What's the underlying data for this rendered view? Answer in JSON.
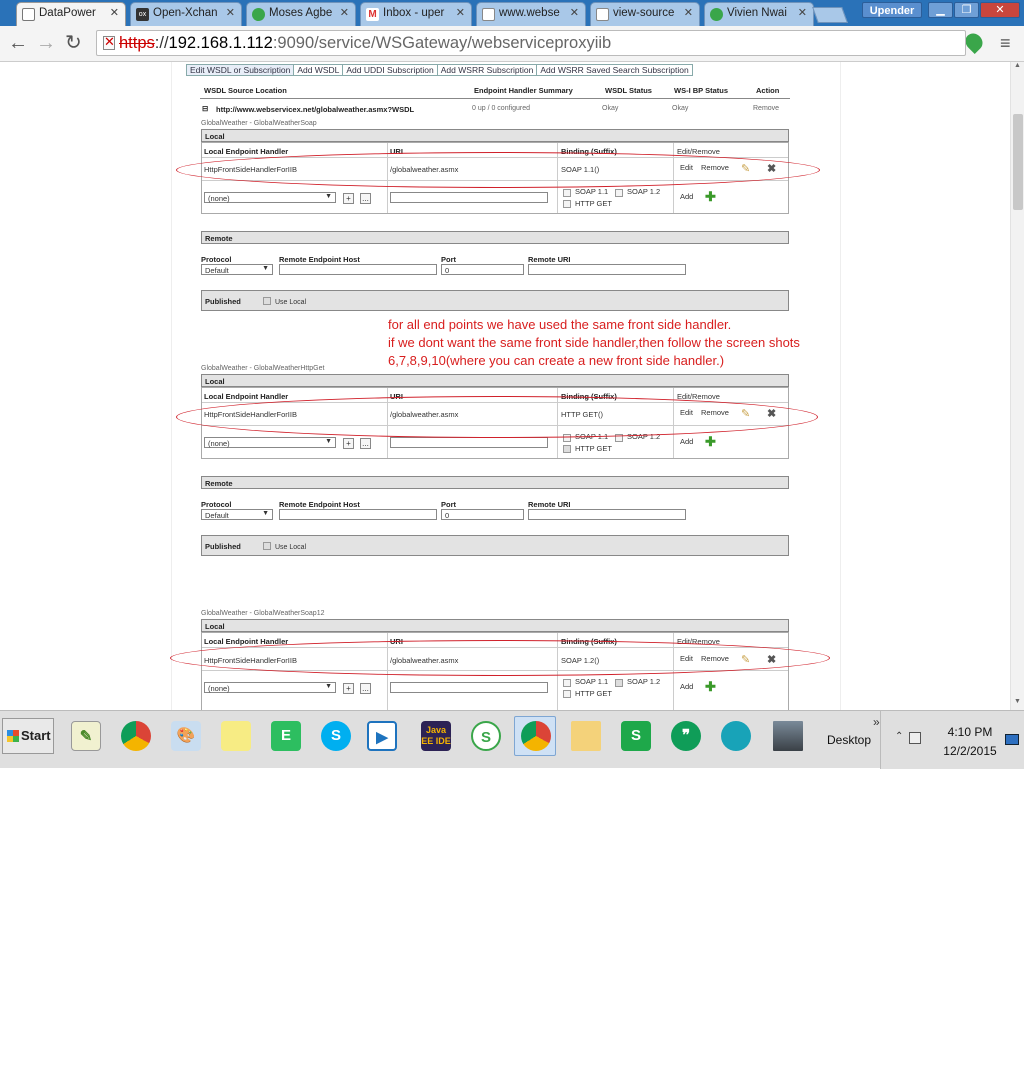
{
  "browser": {
    "tabs": [
      {
        "label": "DataPower",
        "icon": "datapower-doc-icon",
        "active": true
      },
      {
        "label": "Open-Xchan",
        "icon": "ox-icon"
      },
      {
        "label": "Moses Agbe",
        "icon": "globe-icon"
      },
      {
        "label": "Inbox - uper",
        "icon": "gmail-icon"
      },
      {
        "label": "www.webse",
        "icon": "page-icon"
      },
      {
        "label": "view-source",
        "icon": "page-icon"
      },
      {
        "label": "Vivien Nwai",
        "icon": "globe-icon"
      }
    ],
    "profile": "Upender",
    "url": {
      "scheme": "https",
      "sep": "://",
      "host": "192.168.1.112",
      "port": ":9090",
      "path": "/service/WSGateway/webserviceproxyiib"
    }
  },
  "wsdl_tabs": [
    "Edit WSDL or Subscription",
    "Add WSDL",
    "Add UDDI Subscription",
    "Add WSRR Subscription",
    "Add WSRR Saved Search Subscription"
  ],
  "wsdl_header": {
    "source": "WSDL Source Location",
    "summary": "Endpoint Handler Summary",
    "status": "WSDL Status",
    "wsi": "WS-I BP Status",
    "action": "Action"
  },
  "wsdl_row": {
    "toggle": "⊟",
    "location": "http://www.webservicex.net/globalweather.asmx?WSDL",
    "summary": "0 up / 0 configured",
    "status": "Okay",
    "wsi": "Okay",
    "action": "Remove"
  },
  "labels": {
    "local": "Local",
    "remote": "Remote",
    "published": "Published",
    "use_local": "Use Local",
    "handler_col": "Local Endpoint Handler",
    "uri_col": "URI",
    "binding_col": "Binding (Suffix)",
    "editremove_col": "Edit/Remove",
    "edit": "Edit",
    "remove": "Remove",
    "add": "Add",
    "none": "(none)",
    "plus": "+",
    "dots": "...",
    "soap11": "SOAP 1.1",
    "soap12": "SOAP 1.2",
    "httpget": "HTTP GET",
    "protocol": "Protocol",
    "remote_host": "Remote Endpoint Host",
    "port": "Port",
    "remote_uri": "Remote URI",
    "default": "Default",
    "port_value": "0"
  },
  "sections": [
    {
      "title": "GlobalWeather - GlobalWeatherSoap",
      "handler": "HttpFrontSideHandlerForIIB",
      "uri": "/globalweather.asmx",
      "binding": "SOAP 1.1()"
    },
    {
      "title": "GlobalWeather - GlobalWeatherHttpGet",
      "handler": "HttpFrontSideHandlerForIIB",
      "uri": "/globalweather.asmx",
      "binding": "HTTP GET()"
    },
    {
      "title": "GlobalWeather - GlobalWeatherSoap12",
      "handler": "HttpFrontSideHandlerForIIB",
      "uri": "/globalweather.asmx",
      "binding": "SOAP 1.2()"
    }
  ],
  "annotation": {
    "line1": "for all end points we have used the same front side handler.",
    "line2": "if we dont want the same front side handler,then follow the screen shots",
    "line3": "6,7,8,9,10(where you can create a new front side handler.)",
    "color": "#d81e1e"
  },
  "taskbar": {
    "start": "Start",
    "desktop": "Desktop",
    "time": "4:10 PM",
    "date": "12/2/2015",
    "apps": [
      "notepad-plus-icon",
      "chrome-icon",
      "paint-icon",
      "sticky-notes-icon",
      "evernote-icon",
      "skype-icon",
      "media-player-icon",
      "java-ee-ide-icon",
      "sync-icon",
      "chrome-profile-icon",
      "file-explorer-icon",
      "spreadsheet-icon",
      "hangouts-icon",
      "globe-app-icon",
      "photo-viewer-icon"
    ]
  }
}
